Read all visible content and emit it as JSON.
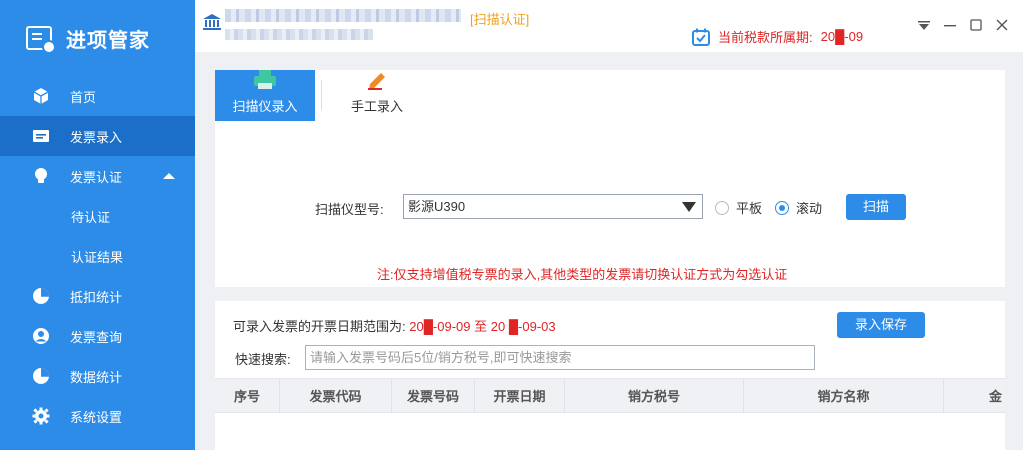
{
  "app": {
    "title": "进项管家"
  },
  "sidebar": {
    "items": [
      {
        "label": "首页",
        "icon": "cube-icon"
      },
      {
        "label": "发票录入",
        "icon": "invoice-icon",
        "active": true
      },
      {
        "label": "发票认证",
        "icon": "lightbulb-icon",
        "expanded": true
      },
      {
        "label": "抵扣统计",
        "icon": "pie-chart-icon"
      },
      {
        "label": "发票查询",
        "icon": "user-circle-icon"
      },
      {
        "label": "数据统计",
        "icon": "pie-chart-icon"
      },
      {
        "label": "系统设置",
        "icon": "gear-icon"
      }
    ],
    "subitems": [
      {
        "label": "待认证"
      },
      {
        "label": "认证结果"
      }
    ]
  },
  "header": {
    "tag": "[扫描认证]",
    "period_label": "当前税款所属期:",
    "period_value": "20█-09",
    "window_controls": [
      "pin-icon",
      "minimize-icon",
      "maximize-icon",
      "close-icon"
    ]
  },
  "scan": {
    "tabs": [
      {
        "label": "扫描仪录入",
        "icon": "scanner-icon",
        "active": true
      },
      {
        "label": "手工录入",
        "icon": "pencil-icon"
      }
    ],
    "model_label": "扫描仪型号:",
    "model_value": "影源U390",
    "mode_options": [
      {
        "label": "平板",
        "checked": false
      },
      {
        "label": "滚动",
        "checked": true
      }
    ],
    "scan_button": "扫描",
    "note": "注:仅支持增值税专票的录入,其他类型的发票请切换认证方式为勾选认证"
  },
  "entry": {
    "range_label": "可录入发票的开票日期范围为:",
    "range_start": "20█-09-09",
    "range_to": "至",
    "range_end": "20 █-09-03",
    "save_button": "录入保存",
    "search_label": "快速搜索:",
    "search_placeholder": "请输入发票号码后5位/销方税号,即可快速搜索",
    "columns": [
      "序号",
      "发票代码",
      "发票号码",
      "开票日期",
      "销方税号",
      "销方名称",
      "金"
    ]
  },
  "colors": {
    "accent": "#2d8ce8",
    "active_nav": "#1c6fc8",
    "warning": "#e02525",
    "tag": "#f0a020"
  }
}
